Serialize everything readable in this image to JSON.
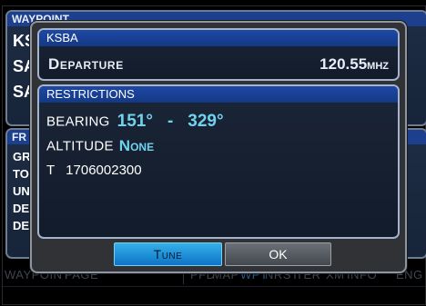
{
  "background_page": {
    "top_box_header": "WAYPOINT",
    "top_lines": [
      "KS",
      "SA",
      "SA"
    ],
    "mid_box_header": "FR",
    "mid_lines": [
      "GR",
      "TO",
      "UN",
      "DE",
      "DE"
    ],
    "softkeys": {
      "waypoint": "WAYPOINT",
      "page": "PAGE",
      "pfd": "PFD",
      "map": "MAP",
      "wpt": "WPT",
      "nrst": "NRST",
      "ter": "TER",
      "xm": "XM",
      "info": "INFO",
      "eng": "ENG"
    }
  },
  "dialog": {
    "frequency_panel": {
      "title": "KSBA",
      "type": "Departure",
      "frequency": "120.55",
      "unit": "MHZ"
    },
    "restrictions_panel": {
      "title": "RESTRICTIONS",
      "bearing_label": "BEARING",
      "bearing_from": "151°",
      "bearing_separator": "-",
      "bearing_to": "329°",
      "altitude_label": "ALTITUDE",
      "altitude_value": "None",
      "ident_prefix": "T",
      "ident_value": "1706002300"
    },
    "buttons": {
      "tune": "Tune",
      "ok": "OK"
    }
  },
  "colors": {
    "accent_cyan": "#6fd3ee",
    "header_blue": "#1e48a6",
    "tune_button": "#1f8fdc",
    "ok_button": "#55595f"
  }
}
